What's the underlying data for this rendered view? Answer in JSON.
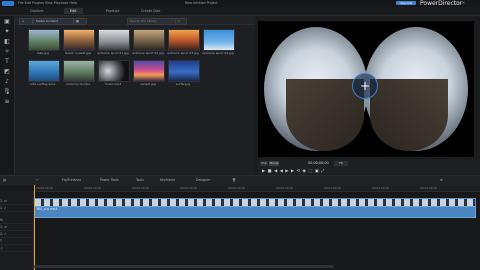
{
  "app": {
    "brand": "PowerDirector",
    "badge": "Upgrade",
    "menu": "File  Edit  Plugins  View  Playback  Help",
    "title": "New Untitled Project"
  },
  "tabs": [
    {
      "label": "Capture"
    },
    {
      "label": "Edit"
    },
    {
      "label": "Produce"
    },
    {
      "label": "Create Disc"
    }
  ],
  "library": {
    "filter_label": "Media Content",
    "search_placeholder": "Search the library",
    "items": [
      {
        "label": "lake.jpg"
      },
      {
        "label": "beach sunset.jpg"
      },
      {
        "label": "extreme sport 01.jpg"
      },
      {
        "label": "extreme sport 02.jpg"
      },
      {
        "label": "extreme sport 03.jpg"
      },
      {
        "label": "extreme sport 04.jpg"
      },
      {
        "label": "kite surfing.wmv"
      },
      {
        "label": "motorcycle.mpo"
      },
      {
        "label": "music.mp3"
      },
      {
        "label": "sunset.jpg"
      },
      {
        "label": "surfer.jpg"
      }
    ]
  },
  "preview": {
    "mode_clip": "Clip",
    "mode_movie": "Movie",
    "timecode": "00;00;00;00",
    "fit_label": "Fit"
  },
  "timeline_toolbar": {
    "items": [
      "Fix/Enhance",
      "Power Tools",
      "Tools",
      "Keyframe",
      "Designer"
    ]
  },
  "ruler": {
    "ticks": [
      "00;00;00;00",
      "00;00;10;00",
      "00;00;20;00",
      "00;00;30;00",
      "00;00;40;00",
      "00;00;50;00",
      "00;01;00;00",
      "00;01;10;00",
      "00;01;20;00",
      "00;01;30;00"
    ]
  },
  "tracks": [
    {
      "label": "1. ⊡"
    },
    {
      "label": "1. ♪"
    },
    {
      "label": "fx"
    },
    {
      "label": "2. ⊡"
    },
    {
      "label": "2. ♪"
    },
    {
      "label": "T"
    },
    {
      "label": "♫"
    }
  ],
  "clip": {
    "label": "360_clip.mp4"
  },
  "colors": {
    "accent": "#3b7fd0",
    "clip": "#4b86c2",
    "playhead": "#e0a330"
  }
}
